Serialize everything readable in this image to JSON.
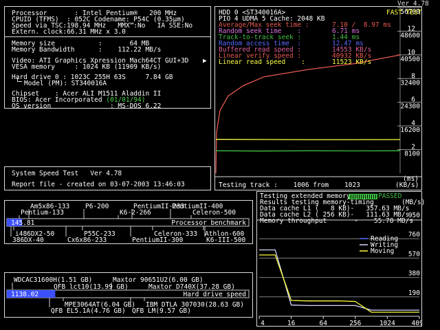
{
  "version": "Ver 4.78",
  "sysinfo": {
    "proc": "Processor       : Intel Pentium®   200 MHz",
    "cpuid": "CPUID (TFMS)  : 052C Codename: P54C (0.35µm)",
    "speed": "Speed via TSC:198.94 MHz   MMX™:No   IA SSE:No",
    "clock": "Extern. clock:66.31 MHz x 3.0",
    "mem": "Memory size           :       64 MB",
    "bw": "Memory Bandwidth      :    112.22 MB/s",
    "video": "Video: ATI Graphics Xpression Mach64CT GUI+3D",
    "vesa": "VESA memory     : 1024 KB (11909 KB/s)",
    "hd": "Hard drive 0 : 1023C 255H 63S     7.84 GB",
    "model": "Model (PM): ST340016A",
    "chipset": "Chipset    : Acer ALI M1511 Aladdin II",
    "bios_lbl": "BIOS: Acer Incorporated ",
    "bios_date": "(01/01/94)",
    "os": "OS version               : MS-DOS 6.22",
    "arrow": "▶"
  },
  "speedtest": {
    "title": "System Speed Test   Ver 4.78",
    "report": "Report file - created on 03-07-2003 13:46:03"
  },
  "hdd": {
    "head1": "HDD 0 <ST340016A>",
    "head2": "PIO 4 UDMA 5 Cache: 2048 KB",
    "fast": "FAST TEST",
    "l1": "Average/Max seek time :",
    "v1": "7.10 /  8.97 ms",
    "l2": "Random seek time    :",
    "v2": "6.71 ms",
    "l3": "Track-to-track seek :",
    "v3": "1.44 ms",
    "l4": "Random access time  :",
    "v4": "12.47 ms",
    "l5": "Buffered read speed :",
    "v5": "14553 KB/s",
    "l6": "Linear verify speed :",
    "v6": "40932 KB/s",
    "l7": "Linear read speed    :",
    "v7": "11523 KB/s",
    "axis_ms": [
      "14",
      "12",
      "10",
      "8",
      "6",
      "4",
      "2"
    ],
    "axis_kb": [
      "56700",
      "48600",
      "40500",
      "32400",
      "24300",
      "16200",
      "8100"
    ],
    "testing": "Testing track :    1006 from    1023",
    "units_ms": "(ms)",
    "units_kb": "(KB/s)"
  },
  "proc_bench": {
    "top1": [
      "Am5x86-133",
      "P6-200",
      "PentiumII-233",
      "PentiumII-400"
    ],
    "top2": [
      "Pentium-133",
      "K6-2-266",
      "Celeron-500"
    ],
    "score": "145.81",
    "label": "Processor benchmark",
    "bot1": [
      "i486DX2-50",
      "P55C-233",
      "Celeron-333",
      "Athlon-600"
    ],
    "bot2": [
      "386DX-40",
      "Cx6x86-233",
      "PentiumII-300",
      "K6-III-500"
    ],
    "fill_fraction": 0.063
  },
  "hd_bench": {
    "top1": [
      "WDCAC31600H(1.51 GB)",
      "Maxtor 90651U2(6.00 GB)"
    ],
    "top2": [
      "QFB lct10(13.99 GB)",
      "Maxtor D740X(37.28 GB)"
    ],
    "score": "1138.02",
    "label": "Hard drive speed",
    "bot1": [
      "MPE3064AT(6.04 GB)",
      "IBM DTLA 307030(28.63 GB)"
    ],
    "bot2": [
      "QFB EL5.1A(4.76 GB)",
      "QFB LM(9.57 GB)"
    ],
    "fill_fraction": 0.2
  },
  "mem_test": {
    "t1": "Testing extended memory...",
    "passed": "PASSED",
    "t2": "Results testing memory-timing",
    "units": "(MB/s)",
    "t3": "Data cache L1 (   8 KB)-   357.63 MB/s",
    "t4": "Data cache L2 ( 256 KB)-   111.63 MB/s",
    "t5": "Memory throughput       -    55.78 MB/s",
    "yaxis": [
      "950",
      "760",
      "570",
      "380",
      "190"
    ],
    "xaxis": [
      "4",
      "16",
      "64",
      "256",
      "1024",
      "4096"
    ],
    "legend": [
      "Reading",
      "Writing",
      "Moving"
    ],
    "color_reading": "#4a66ff",
    "color_writing": "#d8d8ff",
    "color_moving": "#ffff40"
  },
  "chart_data": [
    {
      "type": "line",
      "x": [
        "0",
        "25",
        "50",
        "75",
        "100"
      ],
      "ylim_kbs": [
        0,
        56700
      ],
      "series": [
        {
          "name": "Linear verify speed",
          "color": "#e85a50",
          "values": [
            21000,
            33000,
            35500,
            37500,
            40500
          ]
        },
        {
          "name": "Linear read speed",
          "color": "#ffff40",
          "values": [
            11600,
            11550,
            11500,
            11500,
            11520
          ]
        },
        {
          "name": "Buffered read speed",
          "color": "#40c040",
          "values": [
            7700,
            7600,
            7700,
            7650,
            7700
          ]
        }
      ]
    },
    {
      "type": "line",
      "xlabel": "",
      "x": [
        4,
        8,
        16,
        32,
        64,
        128,
        256,
        512,
        1024,
        4096
      ],
      "ylim": [
        0,
        950
      ],
      "series": [
        {
          "name": "Reading",
          "color": "#4a66ff",
          "values": [
            0,
            0,
            0,
            0,
            0,
            0,
            0,
            0,
            0,
            0
          ]
        },
        {
          "name": "Writing",
          "color": "#d8d8ff",
          "values": [
            650,
            650,
            110,
            105,
            105,
            105,
            105,
            60,
            60,
            60
          ]
        },
        {
          "name": "Moving",
          "color": "#ffff40",
          "values": [
            600,
            600,
            155,
            150,
            150,
            150,
            145,
            40,
            40,
            40
          ]
        }
      ]
    }
  ]
}
